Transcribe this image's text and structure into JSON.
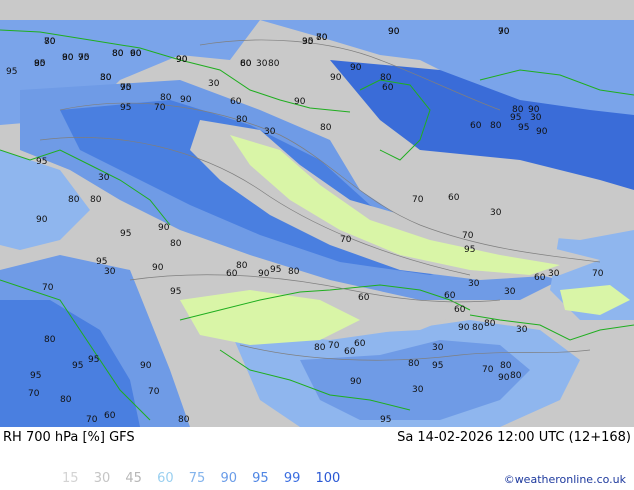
{
  "header": {
    "title": "RH 700 hPa [%] GFS",
    "datetime": "Sa 14-02-2026 12:00 UTC (12+168)",
    "credit": "©weatheronline.co.uk"
  },
  "legend": {
    "items": [
      {
        "label": "15",
        "color": "#d3d3d3"
      },
      {
        "label": "30",
        "color": "#c5c5c5"
      },
      {
        "label": "45",
        "color": "#b7b7b7"
      },
      {
        "label": "60",
        "color": "#9bd0f0"
      },
      {
        "label": "75",
        "color": "#84b4ec"
      },
      {
        "label": "90",
        "color": "#6a9ce8"
      },
      {
        "label": "95",
        "color": "#4f86e4"
      },
      {
        "label": "99",
        "color": "#3b6ee0"
      },
      {
        "label": "100",
        "color": "#2a58d4"
      }
    ]
  },
  "map": {
    "colors": {
      "dry": "#c9c9c9",
      "very_dry": "#d9f5a7",
      "moist_low": "#8fb6ee",
      "moist_mid": "#6f9be6",
      "moist_high": "#4a7fe0",
      "ocean_deep": "#3a6cd8",
      "coast": "#1fae1f",
      "contour": "#7f7f7f"
    },
    "contour_labels": [
      "70",
      "30",
      "70",
      "90",
      "90",
      "95",
      "90",
      "95",
      "80",
      "60",
      "90",
      "80",
      "70",
      "80",
      "30",
      "95",
      "80",
      "90",
      "90",
      "80",
      "60",
      "80",
      "90",
      "30",
      "95",
      "70",
      "60",
      "90",
      "80",
      "30",
      "80",
      "80",
      "90",
      "95",
      "30",
      "60",
      "80",
      "95",
      "90",
      "95",
      "30",
      "80",
      "80",
      "90",
      "95",
      "90",
      "80",
      "70",
      "70",
      "60",
      "70",
      "30",
      "95",
      "95",
      "30",
      "90",
      "80",
      "60",
      "90",
      "95",
      "80",
      "70",
      "95",
      "60",
      "60",
      "30",
      "30",
      "60",
      "30",
      "70",
      "60",
      "90",
      "80",
      "80",
      "30",
      "80",
      "95",
      "90",
      "95",
      "80",
      "70",
      "60",
      "60",
      "30",
      "80",
      "95",
      "90",
      "70",
      "90",
      "80",
      "80",
      "95",
      "70",
      "80",
      "70",
      "30",
      "95",
      "70",
      "60",
      "80",
      "80",
      "95",
      "80",
      "90",
      "70",
      "80",
      "80",
      "70",
      "80",
      "90",
      "90",
      "30",
      "95",
      "60"
    ]
  }
}
